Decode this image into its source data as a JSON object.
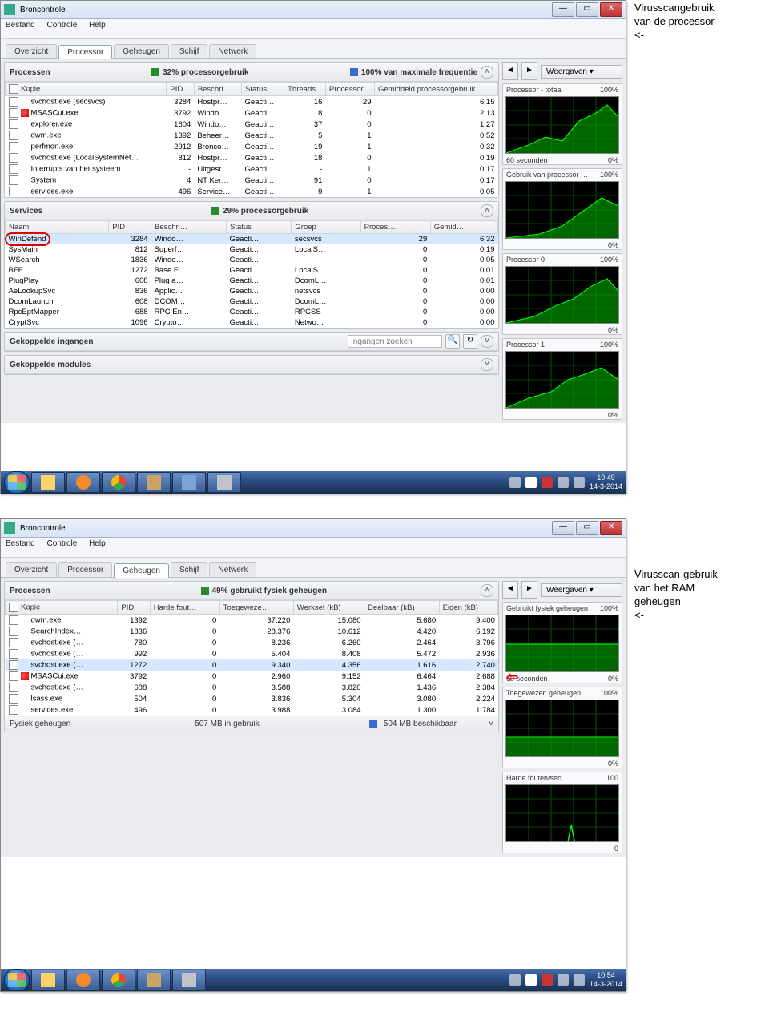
{
  "caption1": {
    "line1": "Virusscangebruik",
    "line2": "van de processor",
    "arrow": "<-"
  },
  "caption2": {
    "line1": "Virusscan-gebruik",
    "line2": "van het RAM",
    "line3": "geheugen",
    "arrow": "<-"
  },
  "win1": {
    "title": "Broncontrole",
    "menu": [
      "Bestand",
      "Controle",
      "Help"
    ],
    "tabs": [
      "Overzicht",
      "Processor",
      "Geheugen",
      "Schijf",
      "Netwerk"
    ],
    "active_tab": 1,
    "proc_header": {
      "left": "Processen",
      "mid_sq": "green",
      "mid": "32% processorgebruik",
      "right_sq": "blue",
      "right": "100% van maximale frequentie"
    },
    "proc_cols": [
      "Kopie",
      "PID",
      "Beschri…",
      "Status",
      "Threads",
      "Processor",
      "Gemiddeld processorgebruik"
    ],
    "proc_rows": [
      {
        "flag": "",
        "name": "svchost.exe (secsvcs)",
        "pid": "3284",
        "desc": "Hostpr…",
        "status": "Geacti…",
        "thr": "16",
        "proc": "29",
        "avg": "6.15"
      },
      {
        "flag": "red",
        "name": "MSASCui.exe",
        "pid": "3792",
        "desc": "Windo…",
        "status": "Geacti…",
        "thr": "8",
        "proc": "0",
        "avg": "2.13"
      },
      {
        "flag": "",
        "name": "explorer.exe",
        "pid": "1604",
        "desc": "Windo…",
        "status": "Geacti…",
        "thr": "37",
        "proc": "0",
        "avg": "1.27"
      },
      {
        "flag": "",
        "name": "dwm.exe",
        "pid": "1392",
        "desc": "Beheer…",
        "status": "Geacti…",
        "thr": "5",
        "proc": "1",
        "avg": "0.52"
      },
      {
        "flag": "",
        "name": "perfmon.exe",
        "pid": "2912",
        "desc": "Bronco…",
        "status": "Geacti…",
        "thr": "19",
        "proc": "1",
        "avg": "0.32"
      },
      {
        "flag": "",
        "name": "svchost.exe (LocalSystemNet…",
        "pid": "812",
        "desc": "Hostpr…",
        "status": "Geacti…",
        "thr": "18",
        "proc": "0",
        "avg": "0.19"
      },
      {
        "flag": "",
        "name": "Interrupts van het systeem",
        "pid": "-",
        "desc": "Uitgest…",
        "status": "Geacti…",
        "thr": "-",
        "proc": "1",
        "avg": "0.17"
      },
      {
        "flag": "",
        "name": "System",
        "pid": "4",
        "desc": "NT Ker…",
        "status": "Geacti…",
        "thr": "91",
        "proc": "0",
        "avg": "0.17"
      },
      {
        "flag": "",
        "name": "services.exe",
        "pid": "496",
        "desc": "Service…",
        "status": "Geacti…",
        "thr": "9",
        "proc": "1",
        "avg": "0.05"
      }
    ],
    "svc_header": {
      "left": "Services",
      "mid": "29% processorgebruik"
    },
    "svc_cols": [
      "Naam",
      "PID",
      "Beschri…",
      "Status",
      "Groep",
      "Proces…",
      "Gemid…"
    ],
    "svc_rows": [
      {
        "mark": true,
        "sel": true,
        "name": "WinDefend",
        "pid": "3284",
        "desc": "Windo…",
        "status": "Geacti…",
        "grp": "secsvcs",
        "proc": "29",
        "avg": "6.32"
      },
      {
        "name": "SysMain",
        "pid": "812",
        "desc": "Superf…",
        "status": "Geacti…",
        "grp": "LocalS…",
        "proc": "0",
        "avg": "0.19"
      },
      {
        "name": "WSearch",
        "pid": "1836",
        "desc": "Windo…",
        "status": "Geacti…",
        "grp": "",
        "proc": "0",
        "avg": "0.05"
      },
      {
        "name": "BFE",
        "pid": "1272",
        "desc": "Base Fi…",
        "status": "Geacti…",
        "grp": "LocalS…",
        "proc": "0",
        "avg": "0.01"
      },
      {
        "name": "PlugPlay",
        "pid": "608",
        "desc": "Plug a…",
        "status": "Geacti…",
        "grp": "DcomL…",
        "proc": "0",
        "avg": "0.01"
      },
      {
        "name": "AeLookupSvc",
        "pid": "836",
        "desc": "Applic…",
        "status": "Geacti…",
        "grp": "netsvcs",
        "proc": "0",
        "avg": "0.00"
      },
      {
        "name": "DcomLaunch",
        "pid": "608",
        "desc": "DCOM…",
        "status": "Geacti…",
        "grp": "DcomL…",
        "proc": "0",
        "avg": "0.00"
      },
      {
        "name": "RpcEptMapper",
        "pid": "688",
        "desc": "RPC En…",
        "status": "Geacti…",
        "grp": "RPCSS",
        "proc": "0",
        "avg": "0.00"
      },
      {
        "name": "CryptSvc",
        "pid": "1096",
        "desc": "Crypto…",
        "status": "Geacti…",
        "grp": "Netwo…",
        "proc": "0",
        "avg": "0.00"
      }
    ],
    "ingangen": {
      "title": "Gekoppelde ingangen",
      "placeholder": "Ingangen zoeken"
    },
    "modules": {
      "title": "Gekoppelde modules"
    },
    "right": {
      "weergaven": "Weergaven",
      "nav_l": "◄",
      "nav_r": "►",
      "dd": "▾",
      "g1": {
        "t": "Processor - totaal",
        "r": "100%",
        "bl": "60 seconden",
        "br": "0%"
      },
      "g2": {
        "t": "Gebruik van processor …",
        "r": "100%",
        "br": "0%"
      },
      "g3": {
        "t": "Processor 0",
        "r": "100%",
        "br": "0%"
      },
      "g4": {
        "t": "Processor 1",
        "r": "100%",
        "br": "0%"
      }
    },
    "clock": {
      "time": "10:49",
      "date": "14-3-2014"
    }
  },
  "win2": {
    "title": "Broncontrole",
    "menu": [
      "Bestand",
      "Controle",
      "Help"
    ],
    "tabs": [
      "Overzicht",
      "Processor",
      "Geheugen",
      "Schijf",
      "Netwerk"
    ],
    "active_tab": 2,
    "proc_header": {
      "left": "Processen",
      "mid": "49% gebruikt fysiek geheugen"
    },
    "proc_cols": [
      "Kopie",
      "PID",
      "Harde fout…",
      "Toegeweze…",
      "Werkset (kB)",
      "Deelbaar (kB)",
      "Eigen (kB)"
    ],
    "proc_rows": [
      {
        "name": "dwm.exe",
        "pid": "1392",
        "hf": "0",
        "tw": "37.220",
        "ws": "15.080",
        "db": "5.680",
        "eg": "9.400"
      },
      {
        "name": "SearchIndex…",
        "pid": "1836",
        "hf": "0",
        "tw": "28.376",
        "ws": "10.612",
        "db": "4.420",
        "eg": "6.192"
      },
      {
        "name": "svchost.exe (…",
        "pid": "780",
        "hf": "0",
        "tw": "8.236",
        "ws": "6.260",
        "db": "2.464",
        "eg": "3.796"
      },
      {
        "name": "svchost.exe (…",
        "pid": "992",
        "hf": "0",
        "tw": "5.404",
        "ws": "8.408",
        "db": "5.472",
        "eg": "2.936"
      },
      {
        "name": "svchost.exe (…",
        "pid": "1272",
        "hf": "0",
        "tw": "9.340",
        "ws": "4.356",
        "db": "1.616",
        "eg": "2.740",
        "sel": true
      },
      {
        "flag": "red",
        "arrow": true,
        "name": "MSASCui.exe",
        "pid": "3792",
        "hf": "0",
        "tw": "2.960",
        "ws": "9.152",
        "db": "6.464",
        "eg": "2.688"
      },
      {
        "name": "svchost.exe (…",
        "pid": "688",
        "hf": "0",
        "tw": "3.588",
        "ws": "3.820",
        "db": "1.436",
        "eg": "2.384"
      },
      {
        "name": "lsass.exe",
        "pid": "504",
        "hf": "0",
        "tw": "3.836",
        "ws": "5.304",
        "db": "3.080",
        "eg": "2.224"
      },
      {
        "name": "services.exe",
        "pid": "496",
        "hf": "0",
        "tw": "3.988",
        "ws": "3.084",
        "db": "1.300",
        "eg": "1.784"
      }
    ],
    "fys": {
      "left": "Fysiek geheugen",
      "mid_sq": "green",
      "mid": "507 MB in gebruik",
      "right_sq": "blue",
      "right": "504 MB beschikbaar"
    },
    "right": {
      "weergaven": "Weergaven",
      "g1": {
        "t": "Gebruikt fysiek geheugen",
        "r": "100%",
        "bl": "60 seconden",
        "br": "0%"
      },
      "g2": {
        "t": "Toegewezen geheugen",
        "r": "100%",
        "br": "0%"
      },
      "g3": {
        "t": "Harde fouten/sec.",
        "r": "100",
        "br": "0"
      }
    },
    "clock": {
      "time": "10:54",
      "date": "14-3-2014"
    }
  }
}
